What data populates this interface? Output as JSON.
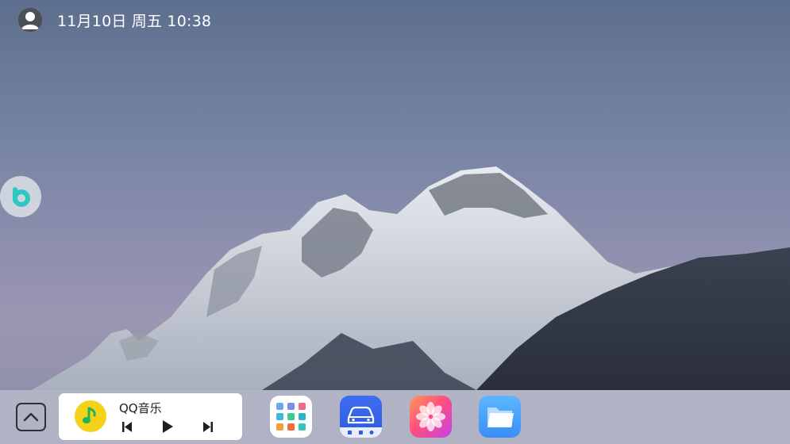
{
  "status_bar": {
    "datetime": "11月10日 周五 10:38",
    "avatar_icon": "user-avatar-icon"
  },
  "assistant": {
    "icon": "assistant-logo-icon",
    "color": "#2ec7c4"
  },
  "dock": {
    "expand_icon": "chevron-up-icon",
    "music_widget": {
      "app_name": "QQ音乐",
      "logo_icon": "qq-music-logo-icon",
      "controls": [
        "previous-icon",
        "play-icon",
        "next-icon"
      ]
    },
    "apps": [
      {
        "name": "app-drawer",
        "icon": "app-grid-icon"
      },
      {
        "name": "car-app",
        "icon": "car-icon"
      },
      {
        "name": "gallery-app",
        "icon": "gallery-flower-icon"
      },
      {
        "name": "file-manager-app",
        "icon": "folder-icon"
      }
    ]
  },
  "colors": {
    "dock_bg": "#cdd2da",
    "music_yellow": "#f4d218",
    "music_green": "#1fb35a",
    "car_blue": "#2e5be0",
    "files_blue": "#3a8df6"
  }
}
